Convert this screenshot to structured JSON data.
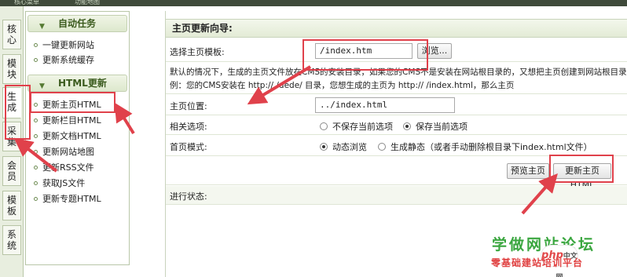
{
  "topbar": {
    "left_text": "核心菜单",
    "mid_text": "功能地图"
  },
  "vtabs": [
    "核心",
    "模块",
    "生成",
    "采集",
    "会员",
    "模板",
    "系统"
  ],
  "sidebar": {
    "sections": [
      {
        "title": "自动任务",
        "items": [
          "一键更新网站",
          "更新系统缓存"
        ]
      },
      {
        "title": "HTML更新",
        "items": [
          "更新主页HTML",
          "更新栏目HTML",
          "更新文档HTML",
          "更新网站地图",
          "更新RSS文件",
          "获取JS文件",
          "更新专题HTML"
        ]
      }
    ]
  },
  "main": {
    "title": "主页更新向导:",
    "template_label": "选择主页模板:",
    "template_value": "/index.htm",
    "browse_label": "浏览...",
    "note_line1": "默认的情况下，生成的主页文件放在CMS的安装目录，如果您的CMS不是安装在网站根目录的，又想把主页创建到网站根目录",
    "note_line2": "例：您的CMS安装在 http://                    /dede/ 目录，您想生成的主页为 http://               /index.html，那么主页",
    "position_label": "主页位置:",
    "position_value": "../index.html",
    "options_label": "相关选项:",
    "options": [
      {
        "label": "不保存当前选项",
        "selected": false
      },
      {
        "label": "保存当前选项",
        "selected": true
      }
    ],
    "mode_label": "首页模式:",
    "modes": [
      {
        "label": "动态浏览",
        "selected": true
      },
      {
        "label": "生成静态（或者手动删除根目录下index.html文件）",
        "selected": false
      }
    ],
    "preview_button": "预览主页",
    "update_button": "更新主页HTML",
    "status_label": "进行状态:"
  },
  "watermark": {
    "line1": "学做网站论坛",
    "line2": "零基础建站培训平台",
    "logo_text": "php",
    "logo_suffix": "中文网"
  },
  "colors": {
    "highlight": "#e0414b",
    "watermark_green": "#3aa63f",
    "watermark_red": "#e04040"
  }
}
